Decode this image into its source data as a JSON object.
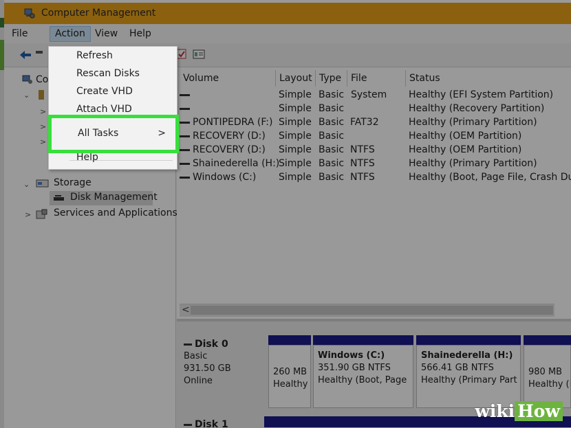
{
  "window": {
    "title": "Computer Management"
  },
  "menubar": {
    "items": [
      "File",
      "Action",
      "View",
      "Help"
    ]
  },
  "tree": {
    "root_label": "Co",
    "storage": "Storage",
    "disk_management": "Disk Management",
    "services": "Services and Applications"
  },
  "volumes": {
    "headers": [
      "Volume",
      "Layout",
      "Type",
      "File System",
      "Status"
    ],
    "rows": [
      {
        "volume": "",
        "layout": "Simple",
        "type": "Basic",
        "fs": "",
        "status": "Healthy (EFI System Partition)"
      },
      {
        "volume": "",
        "layout": "Simple",
        "type": "Basic",
        "fs": "",
        "status": "Healthy (Recovery Partition)"
      },
      {
        "volume": "PONTIPEDRA (F:)",
        "layout": "Simple",
        "type": "Basic",
        "fs": "FAT32",
        "status": "Healthy (Primary Partition)"
      },
      {
        "volume": "RECOVERY (D:)",
        "layout": "Simple",
        "type": "Basic",
        "fs": "",
        "status": "Healthy (OEM Partition)"
      },
      {
        "volume": "RECOVERY (D:)",
        "layout": "Simple",
        "type": "Basic",
        "fs": "NTFS",
        "status": "Healthy (OEM Partition)"
      },
      {
        "volume": "Shainederella (H:)",
        "layout": "Simple",
        "type": "Basic",
        "fs": "NTFS",
        "status": "Healthy (Primary Partition)"
      },
      {
        "volume": "Windows (C:)",
        "layout": "Simple",
        "type": "Basic",
        "fs": "NTFS",
        "status": "Healthy (Boot, Page File, Crash Dump"
      }
    ]
  },
  "disk0": {
    "name": "Disk 0",
    "type": "Basic",
    "size": "931.50 GB",
    "state": "Online",
    "partitions": [
      {
        "name": "",
        "line1": "260 MB",
        "line2": "Healthy"
      },
      {
        "name": "Windows  (C:)",
        "line1": "351.90 GB NTFS",
        "line2": "Healthy (Boot, Page"
      },
      {
        "name": "Shainederella  (H:)",
        "line1": "566.41 GB NTFS",
        "line2": "Healthy (Primary Part"
      },
      {
        "name": "",
        "line1": "980 MB",
        "line2": "Healthy (I"
      }
    ]
  },
  "disk1": {
    "name": "Disk 1"
  },
  "action_menu": {
    "items": [
      "Refresh",
      "Rescan Disks",
      "Create VHD",
      "Attach VHD",
      "All Tasks",
      "Help"
    ],
    "submenu_arrow": ">"
  },
  "watermark": {
    "part1": "wiki",
    "part2": "How"
  },
  "colors": {
    "titlebar": "#e8a21a",
    "highlight": "#36e03a",
    "disk_bar": "#1b1b8a"
  }
}
